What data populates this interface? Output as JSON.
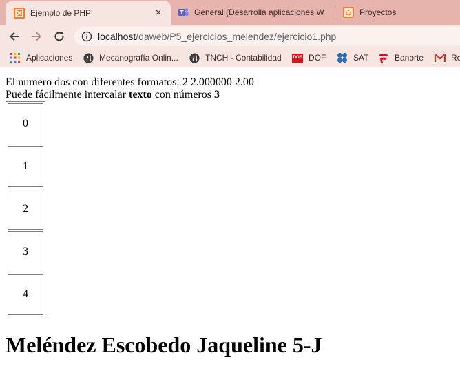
{
  "browser": {
    "tabs": [
      {
        "title": "Ejemplo de PHP",
        "active": true,
        "favicon": "xampp-icon",
        "close": "×"
      },
      {
        "title": "General (Desarrolla aplicaciones W",
        "active": false,
        "favicon": "teams-icon"
      },
      {
        "title": "Proyectos",
        "active": false,
        "favicon": "xampp-icon"
      }
    ],
    "url": {
      "host": "localhost",
      "path": "/daweb/P5_ejercicios_melendez/ejercicio1.php"
    },
    "bookmarks": [
      {
        "label": "Aplicaciones",
        "icon": "apps-grid-icon"
      },
      {
        "label": "Mecanografía Onlin...",
        "icon": "globe-icon"
      },
      {
        "label": "TNCH - Contabilidad",
        "icon": "globe-icon"
      },
      {
        "label": "DOF",
        "icon": "dof-icon"
      },
      {
        "label": "SAT",
        "icon": "sat-icon"
      },
      {
        "label": "Banorte",
        "icon": "banorte-icon"
      },
      {
        "label": "Re",
        "icon": "gmail-icon"
      }
    ],
    "dof_badge": "DOF"
  },
  "page": {
    "line1": "El numero dos con diferentes formatos: 2 2.000000 2.00",
    "line2_prefix": "Puede fácilmente intercalar ",
    "line2_bold1": "texto",
    "line2_mid": " con números ",
    "line2_bold2": "3",
    "table_cells": [
      "0",
      "1",
      "2",
      "3",
      "4"
    ],
    "heading": "Meléndez Escobedo Jaqueline 5-J"
  },
  "colors": {
    "tabstrip": "#e6b3ad",
    "toolbar": "#f7e5e2",
    "xampp": "#fb7a24",
    "teams": "#5b5fc7"
  }
}
